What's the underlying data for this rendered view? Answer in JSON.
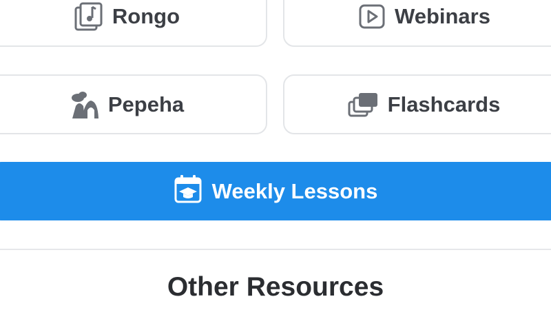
{
  "grid": {
    "rongo": {
      "label": "Rongo",
      "icon": "music-note-stack-icon"
    },
    "webinars": {
      "label": "Webinars",
      "icon": "play-box-icon"
    },
    "pepeha": {
      "label": "Pepeha",
      "icon": "mountain-people-icon"
    },
    "flashcards": {
      "label": "Flashcards",
      "icon": "card-stack-icon"
    }
  },
  "weekly_lessons": {
    "label": "Weekly Lessons",
    "icon": "calendar-graduation-icon",
    "color": "#1d8cea"
  },
  "other_resources": {
    "title": "Other Resources"
  }
}
